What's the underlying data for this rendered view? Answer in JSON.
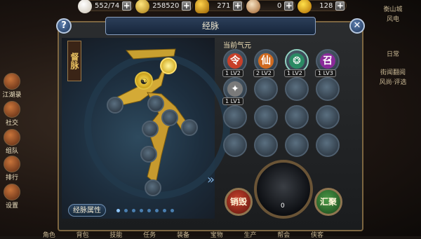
{
  "resources": [
    {
      "icon": "egg-icon",
      "value": "552/74"
    },
    {
      "icon": "gold-coin-icon",
      "value": "258520"
    },
    {
      "icon": "gold-ingot-icon",
      "value": "271"
    },
    {
      "icon": "scroll-icon",
      "value": "0"
    },
    {
      "icon": "lightning-icon",
      "value": "128"
    }
  ],
  "side_left": [
    {
      "label": "江湖录"
    },
    {
      "label": "社交"
    },
    {
      "label": "组队"
    },
    {
      "label": "排行"
    },
    {
      "label": "设置"
    }
  ],
  "panel": {
    "title": "经脉",
    "help": "?",
    "close": "✕",
    "vertical_label": "督脉",
    "attr_button": "经脉属性",
    "section_label": "当前气元"
  },
  "slots": [
    {
      "gem": "令",
      "color": "#c8402a",
      "count": "1",
      "lv": "LV2"
    },
    {
      "gem": "仙",
      "color": "#d06a20",
      "count": "2",
      "lv": "LV2"
    },
    {
      "gem": "❂",
      "color": "#2a8a64",
      "count": "1",
      "lv": "LV2"
    },
    {
      "gem": "召",
      "color": "#8a2a9a",
      "count": "1",
      "lv": "LV3"
    },
    {
      "gem": "✦",
      "color": "#7a7a7a",
      "count": "1",
      "lv": "LV1"
    }
  ],
  "orb_value": "0",
  "buttons": {
    "destroy": "销毁",
    "gather": "汇聚"
  },
  "right_menu": [
    "衡山城",
    "风电",
    "日常",
    "街闻翻阅",
    "风尚·评选"
  ],
  "bottom_nav": [
    "角色",
    "背包",
    "技能",
    "任务",
    "装备",
    "宝物",
    "生产",
    "帮会",
    "侠客"
  ],
  "colors": {
    "accent": "#7c6540",
    "title_bar": "#2c3f5a"
  }
}
